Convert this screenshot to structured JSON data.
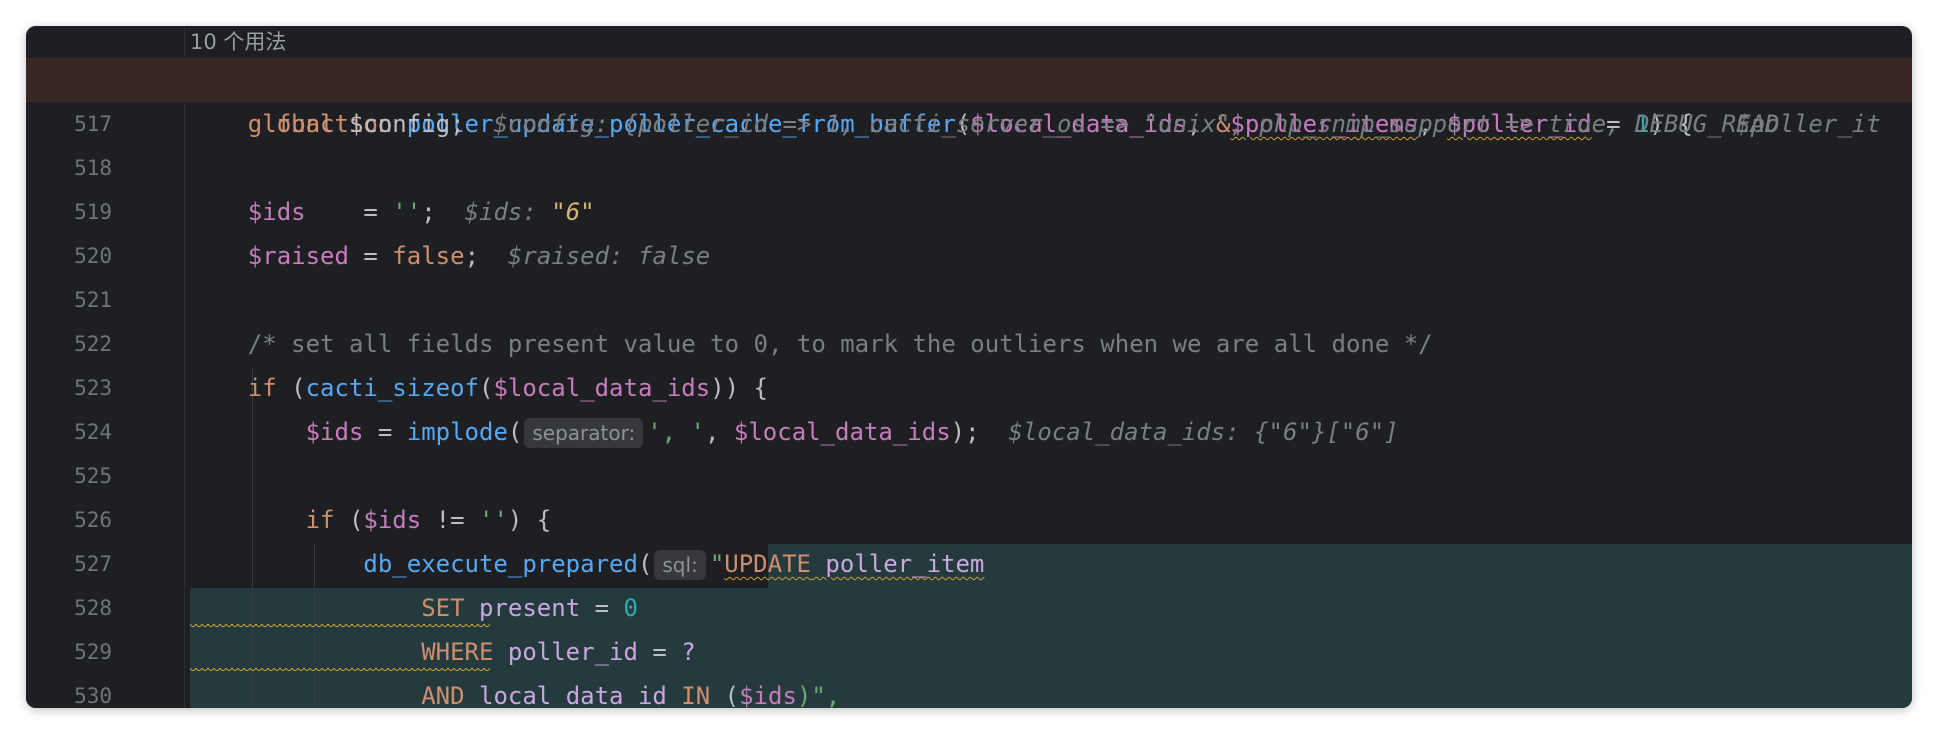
{
  "editor": {
    "usages_label": "10 个用法",
    "function_line": {
      "kw_function": "function",
      "fn_name": "poller_update_poller_cache_from_buffer",
      "open": "(",
      "p1": "$local_data_ids",
      "comma1": ", ",
      "amp": "&",
      "p2": "$poller_items",
      "comma2": ", ",
      "p3": "$poller_id",
      "eq": " = ",
      "default": "1",
      "close": ") {",
      "inline_hint": "$poller_it"
    },
    "lines": [
      {
        "num": "517"
      },
      {
        "num": "518"
      },
      {
        "num": "519"
      },
      {
        "num": "520"
      },
      {
        "num": "521"
      },
      {
        "num": "522"
      },
      {
        "num": "523"
      },
      {
        "num": "524"
      },
      {
        "num": "525"
      },
      {
        "num": "526"
      },
      {
        "num": "527"
      },
      {
        "num": "528"
      },
      {
        "num": "529"
      },
      {
        "num": "530"
      }
    ],
    "l517": {
      "global": "global",
      "var": " $config;",
      "hint": "$config: {poller_id => 1, cacti_server_os => \"unix\", php_snmp_support => true, DEBUG_READ"
    },
    "l519": {
      "var": "$ids",
      "pad": "    = ",
      "str": "''",
      "semi": ";",
      "hint_label": "$ids: ",
      "hint_val": "\"6\""
    },
    "l520": {
      "var": "$raised",
      "eq": " = ",
      "kw": "false",
      "semi": ";",
      "hint": "$raised: false"
    },
    "l522": {
      "comment": "/* set all fields present value to 0, to mark the outliers when we are all done */"
    },
    "l523": {
      "if": "if",
      "open": " (",
      "fn": "cacti_sizeof",
      "paren": "(",
      "var": "$local_data_ids",
      "close": ")) {"
    },
    "l524": {
      "var": "$ids",
      "eq": " = ",
      "fn": "implode",
      "paren": "(",
      "param_hint": "separator:",
      "str": "', '",
      "comma": ", ",
      "arg": "$local_data_ids",
      "close": ");",
      "hint": "$local_data_ids: {\"6\"}[\"6\"]"
    },
    "l526": {
      "if": "if",
      "open": " (",
      "var": "$ids",
      "neq": " != ",
      "str": "''",
      "close": ") {"
    },
    "l527": {
      "fn": "db_execute_prepared",
      "paren": "(",
      "param_hint": "sql:",
      "quote": "\"",
      "sql_kw": "UPDATE",
      "table": " poller_item"
    },
    "l528": {
      "kw": "SET",
      "col": " present",
      "eq": " = ",
      "num": "0"
    },
    "l529": {
      "kw": "WHERE",
      "col": " poller_id",
      "eq": " = ",
      "q": "?"
    },
    "l530": {
      "kw": "AND",
      "col": " local_data_id",
      "in": " IN",
      "open": " (",
      "var": "$ids",
      "close": ")\","
    }
  },
  "colors": {
    "background": "#1e1f22",
    "keyword": "#cf8e6d",
    "variable": "#c77dbb",
    "function": "#56a8f5",
    "string": "#6aab73",
    "number": "#2aacb8",
    "comment": "#7a7e85",
    "breakpoint": "#e8495a"
  }
}
